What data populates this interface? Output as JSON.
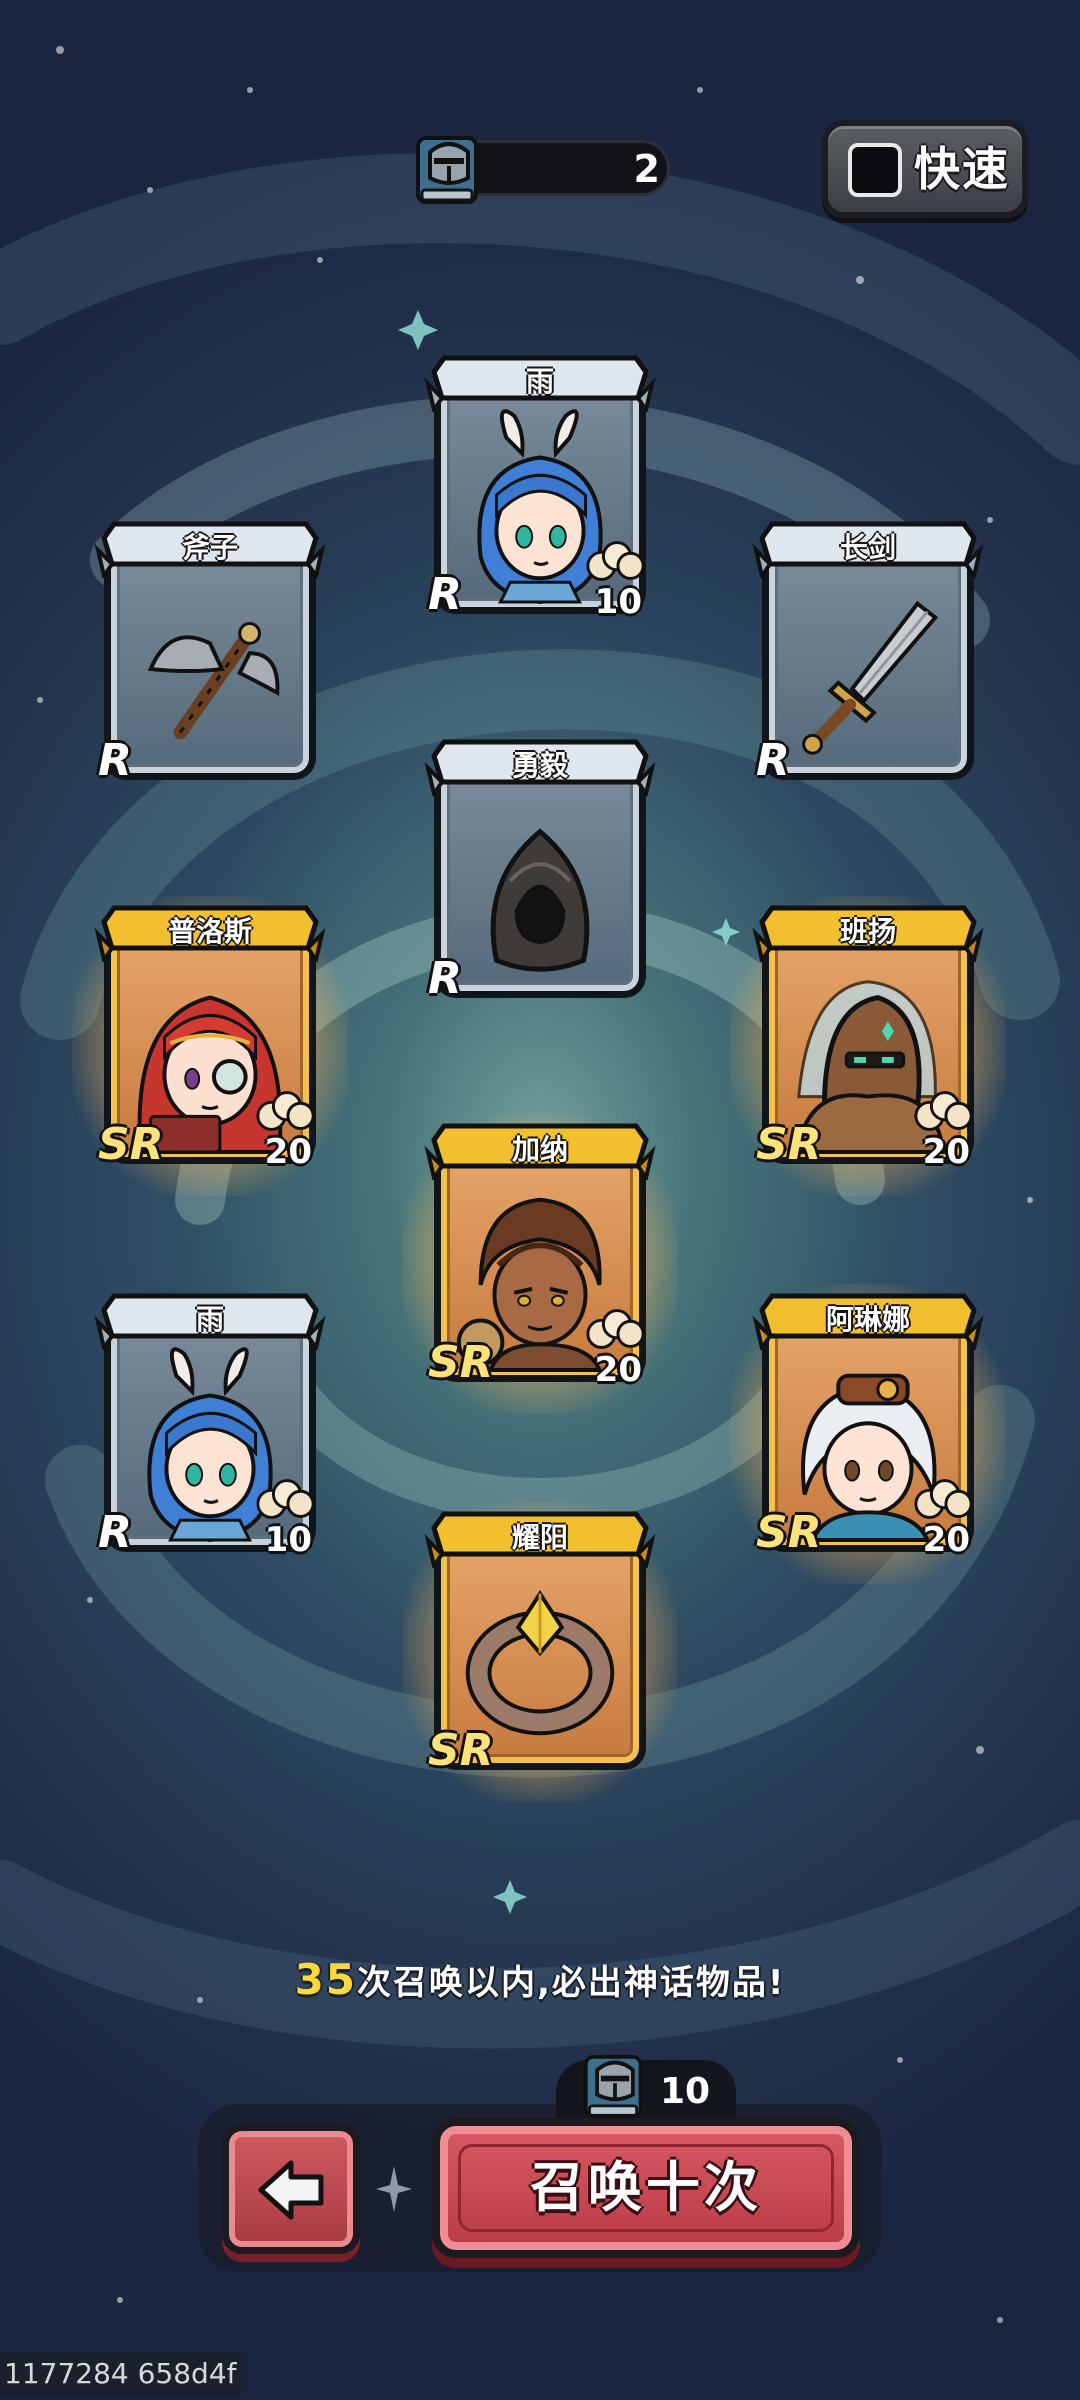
{
  "top_bar": {
    "ticket_icon": "knight-helmet-book-icon",
    "ticket_count": "2",
    "fast_label": "快速",
    "fast_checked": false
  },
  "cards": [
    {
      "name": "雨",
      "rarity": "R",
      "quantity": "10",
      "art": "blue-haired-bunny-girl"
    },
    {
      "name": "斧子",
      "rarity": "R",
      "quantity": "",
      "art": "battle-axe"
    },
    {
      "name": "长剑",
      "rarity": "R",
      "quantity": "",
      "art": "long-sword"
    },
    {
      "name": "勇毅",
      "rarity": "R",
      "quantity": "",
      "art": "dark-hood"
    },
    {
      "name": "普洛斯",
      "rarity": "SR",
      "quantity": "20",
      "art": "red-haired-scholar-girl"
    },
    {
      "name": "班扬",
      "rarity": "SR",
      "quantity": "20",
      "art": "bronze-masked-warrior"
    },
    {
      "name": "加纳",
      "rarity": "SR",
      "quantity": "20",
      "art": "dreadlocked-engineer"
    },
    {
      "name": "雨",
      "rarity": "R",
      "quantity": "10",
      "art": "blue-haired-bunny-girl"
    },
    {
      "name": "阿琳娜",
      "rarity": "SR",
      "quantity": "20",
      "art": "white-haired-pilot-girl"
    },
    {
      "name": "耀阳",
      "rarity": "SR",
      "quantity": "",
      "art": "gem-ring"
    }
  ],
  "pity": {
    "number": "35",
    "text": "次召唤以内,必出神话物品!"
  },
  "bottom": {
    "cost_icon": "knight-helmet-book-icon",
    "cost": "10",
    "back_icon": "back-arrow-icon",
    "summon_label": "召唤十次"
  },
  "device_id": "1177284 658d4f",
  "colors": {
    "r_frame": "#c9d3dc",
    "sr_frame": "#f3c24a",
    "summon_button": "#c8474f",
    "pity_highlight": "#ffd93a"
  }
}
